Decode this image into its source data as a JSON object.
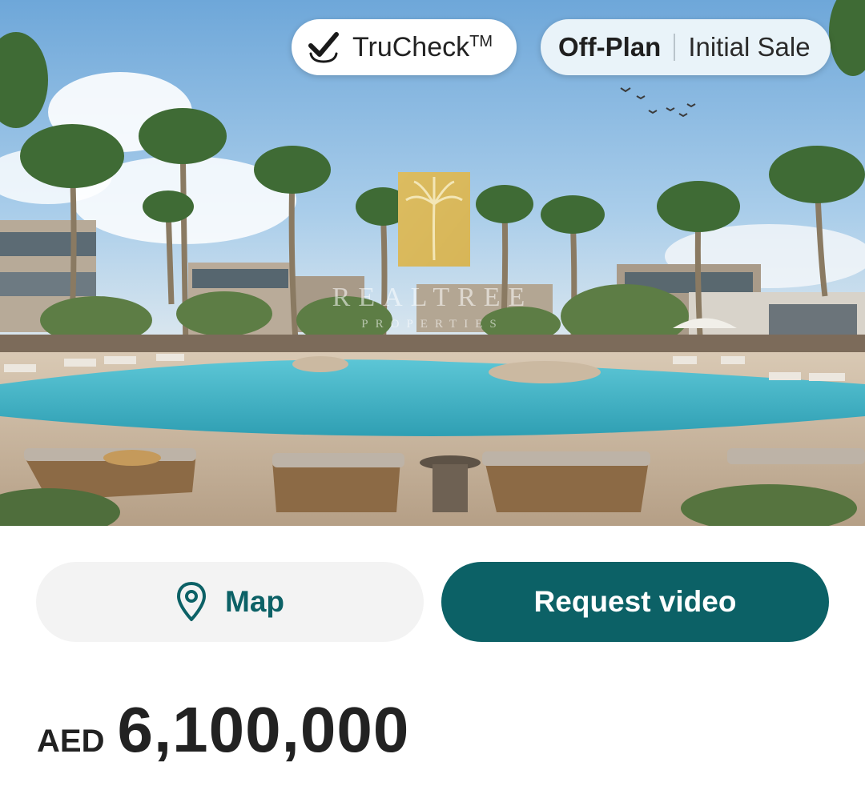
{
  "hero": {
    "watermark": {
      "title": "REALTREE",
      "subtitle": "PROPERTIES"
    },
    "badges": {
      "trucheck_label": "TruCheck",
      "trucheck_mark": "TM",
      "status_primary": "Off-Plan",
      "status_secondary": "Initial Sale"
    }
  },
  "actions": {
    "map_label": "Map",
    "map_icon": "map-pin-icon",
    "request_video_label": "Request video"
  },
  "price": {
    "currency": "AED",
    "amount": "6,100,000"
  },
  "colors": {
    "brand_teal": "#0c6166",
    "map_button_bg": "#f3f3f3",
    "status_badge_bg": "#e9f3f9"
  }
}
